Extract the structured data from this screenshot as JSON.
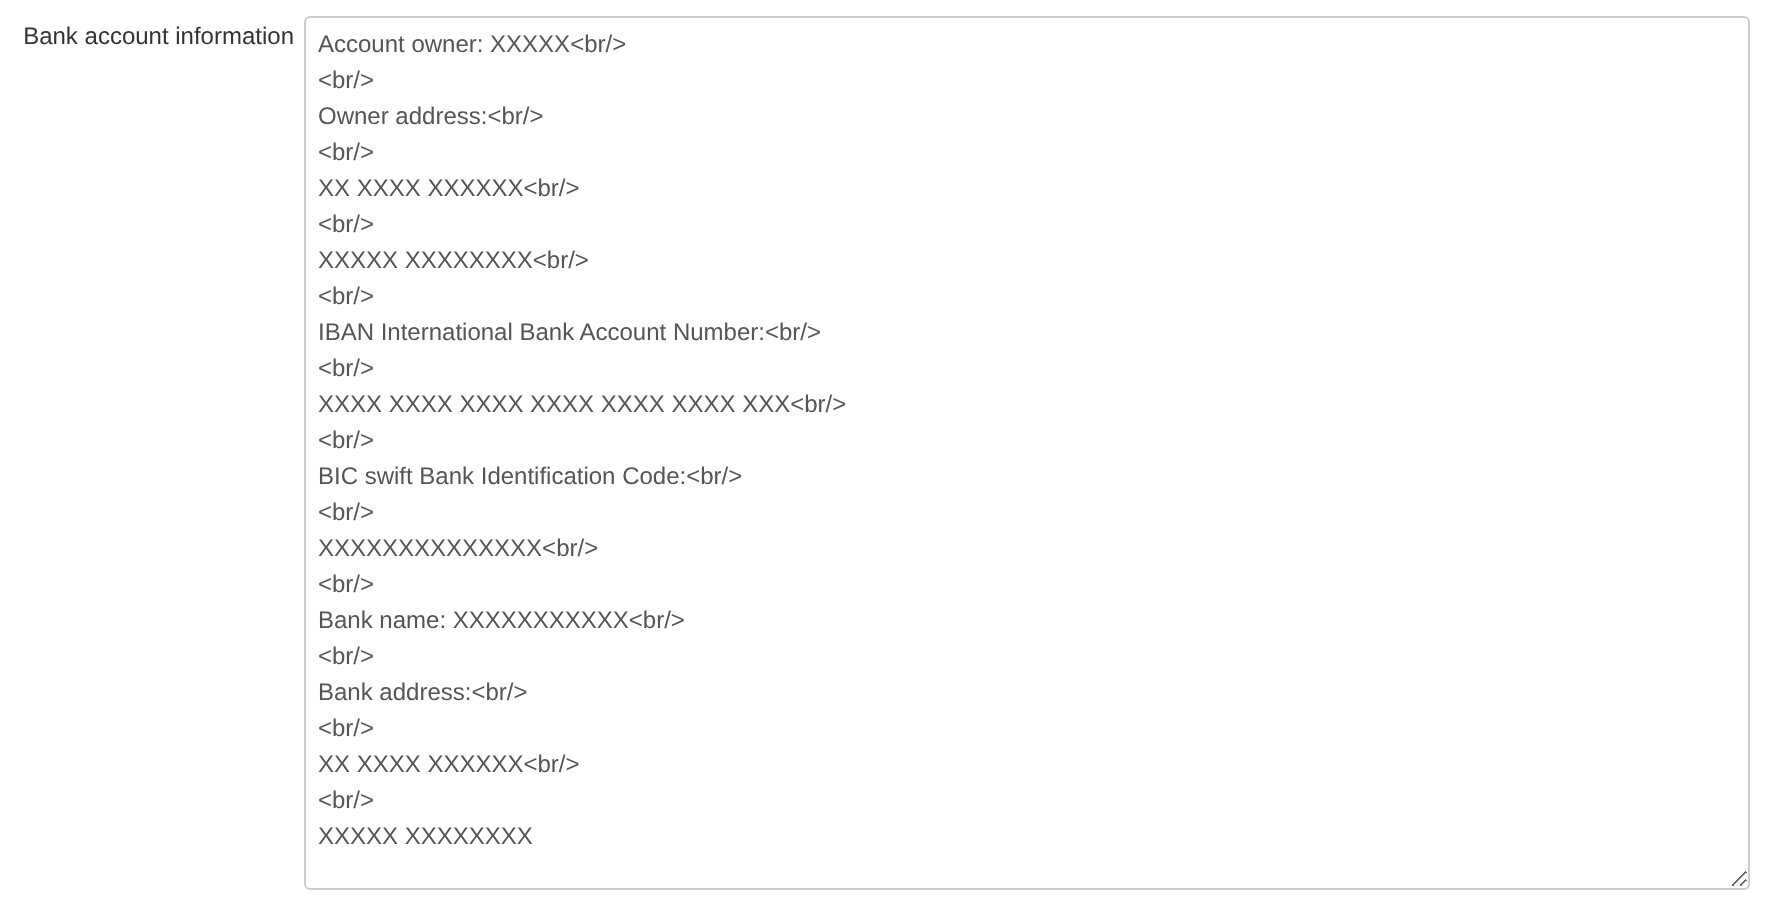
{
  "field": {
    "label": "Bank account information",
    "value_lines": [
      "Account owner: XXXXX<br/>",
      "<br/>",
      "Owner address:<br/>",
      "<br/>",
      "XX XXXX XXXXXX<br/>",
      "<br/>",
      "XXXXX XXXXXXXX<br/>",
      "<br/>",
      "IBAN International Bank Account Number:<br/>",
      "<br/>",
      "XXXX XXXX XXXX XXXX XXXX XXXX XXX<br/>",
      "<br/>",
      "BIC swift Bank Identification Code:<br/>",
      "<br/>",
      "XXXXXXXXXXXXXX<br/>",
      "<br/>",
      "Bank name: XXXXXXXXXXX<br/>",
      "<br/>",
      "Bank address:<br/>",
      "<br/>",
      "XX XXXX XXXXXX<br/>",
      "<br/>",
      "XXXXX XXXXXXXX"
    ]
  }
}
